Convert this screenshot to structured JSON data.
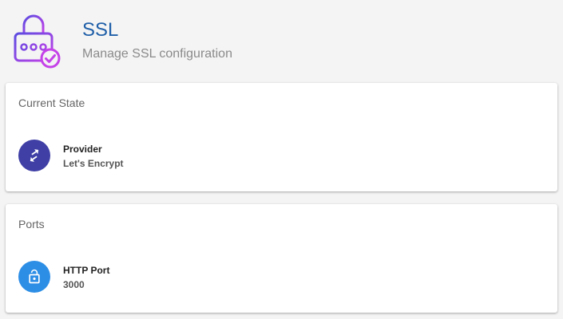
{
  "header": {
    "title": "SSL",
    "subtitle": "Manage SSL configuration",
    "icon": "ssl-lock-check-icon",
    "icon_colors": [
      "#5b4ce0",
      "#c542e8"
    ]
  },
  "cards": {
    "current_state": {
      "title": "Current State",
      "item": {
        "label": "Provider",
        "value": "Let's Encrypt",
        "icon": "swap-arrows-icon",
        "icon_color": "#3f3fa6"
      }
    },
    "ports": {
      "title": "Ports",
      "item": {
        "label": "HTTP Port",
        "value": "3000",
        "icon": "unlocked-padlock-icon",
        "icon_color": "#2d8ee6"
      }
    }
  }
}
